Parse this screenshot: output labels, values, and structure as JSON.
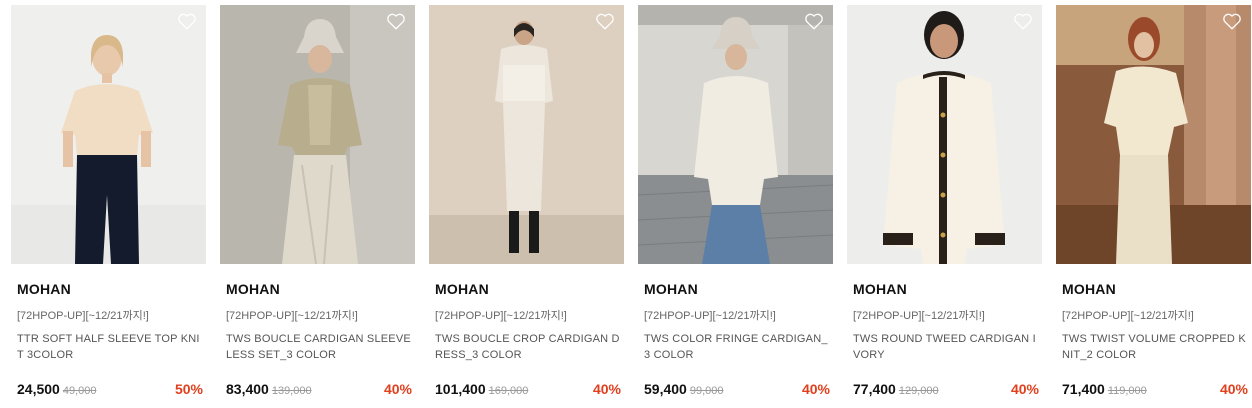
{
  "products": [
    {
      "brand": "MOHAN",
      "promo": "[72HPOP-UP][~12/21까지!]",
      "name": "TTR SOFT HALF SLEEVE TOP KNIT 3COLOR",
      "price": "24,500",
      "original_price": "49,000",
      "discount": "50%",
      "wishlist_icon": "heart-outline-icon"
    },
    {
      "brand": "MOHAN",
      "promo": "[72HPOP-UP][~12/21까지!]",
      "name": "TWS BOUCLE CARDIGAN SLEEVELESS SET_3 COLOR",
      "price": "83,400",
      "original_price": "139,000",
      "discount": "40%",
      "wishlist_icon": "heart-outline-icon"
    },
    {
      "brand": "MOHAN",
      "promo": "[72HPOP-UP][~12/21까지!]",
      "name": "TWS BOUCLE CROP CARDIGAN DRESS_3 COLOR",
      "price": "101,400",
      "original_price": "169,000",
      "discount": "40%",
      "wishlist_icon": "heart-outline-icon"
    },
    {
      "brand": "MOHAN",
      "promo": "[72HPOP-UP][~12/21까지!]",
      "name": "TWS COLOR FRINGE CARDIGAN_3 COLOR",
      "price": "59,400",
      "original_price": "99,000",
      "discount": "40%",
      "wishlist_icon": "heart-outline-icon"
    },
    {
      "brand": "MOHAN",
      "promo": "[72HPOP-UP][~12/21까지!]",
      "name": "TWS ROUND TWEED CARDIGAN IVORY",
      "price": "77,400",
      "original_price": "129,000",
      "discount": "40%",
      "wishlist_icon": "heart-outline-icon"
    },
    {
      "brand": "MOHAN",
      "promo": "[72HPOP-UP][~12/21까지!]",
      "name": "TWS TWIST VOLUME CROPPED KNIT_2 COLOR",
      "price": "71,400",
      "original_price": "119,000",
      "discount": "40%",
      "wishlist_icon": "heart-outline-icon"
    }
  ],
  "colors": {
    "discount": "#e0401e",
    "price": "#111111",
    "original_price": "#999999",
    "promo": "#666666",
    "name": "#555555"
  }
}
